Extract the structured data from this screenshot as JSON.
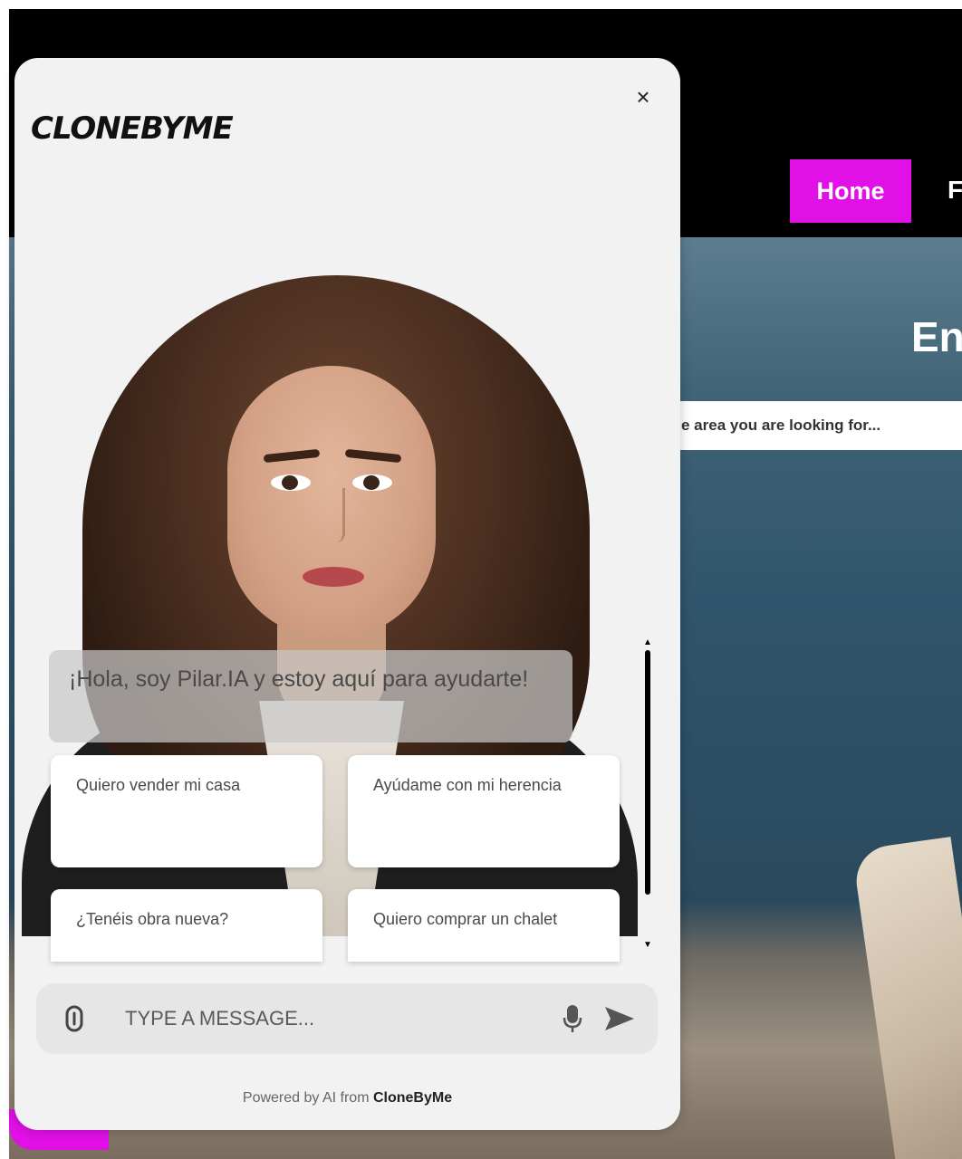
{
  "site": {
    "nav": {
      "home_label": "Home",
      "next_label_partial": "F"
    },
    "hero": {
      "title_partial": "En",
      "search_placeholder": "e area you are looking for..."
    },
    "colors": {
      "accent": "#e010e6"
    }
  },
  "widget": {
    "close_symbol": "×",
    "logo_text": "CLONEBYME",
    "greeting": "¡Hola, soy Pilar.IA y estoy aquí para ayudarte!",
    "suggestions": [
      "Quiero vender mi casa",
      "Ayúdame con mi herencia",
      "¿Tenéis obra nueva?",
      "Quiero comprar un chalet"
    ],
    "input_placeholder": "TYPE A MESSAGE...",
    "icons": [
      "attachment-icon",
      "microphone-icon",
      "send-icon"
    ],
    "powered_prefix": "Powered by AI from ",
    "powered_brand": "CloneByMe"
  }
}
